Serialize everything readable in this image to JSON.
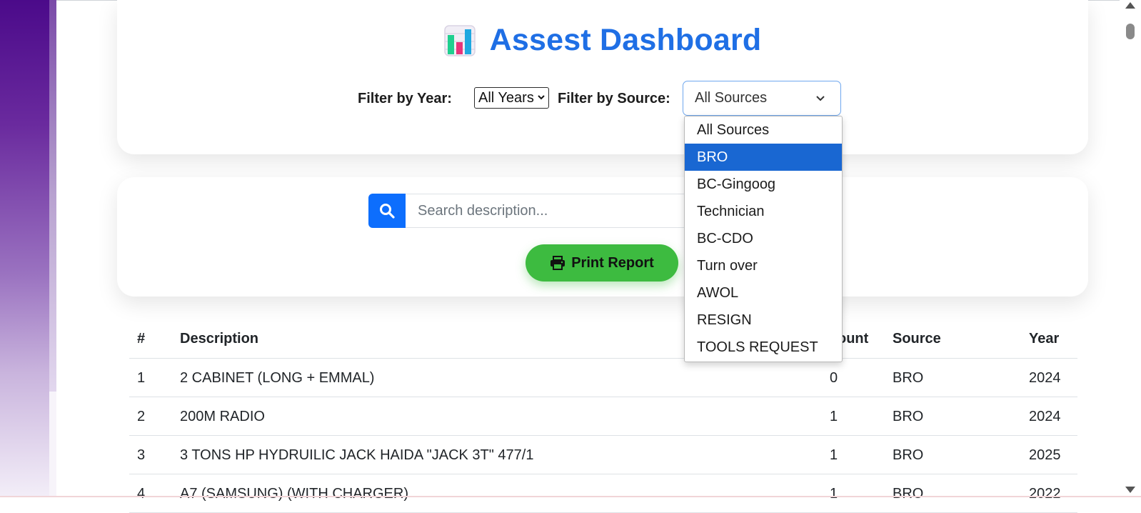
{
  "dashboard": {
    "title": "Assest Dashboard",
    "icon": "bar-chart-icon"
  },
  "filters": {
    "year_label": "Filter by Year:",
    "year_selected": "All Years",
    "source_label": "Filter by Source:",
    "source_selected": "All Sources"
  },
  "source_dropdown": {
    "options": [
      "All Sources",
      "BRO",
      "BC-Gingoog",
      "Technician",
      "BC-CDO",
      "Turn over",
      "AWOL",
      "RESIGN",
      "TOOLS REQUEST"
    ],
    "highlighted": "BRO"
  },
  "search": {
    "placeholder": "Search description..."
  },
  "print_button": {
    "label": "Print Report",
    "color": "#3dbb40"
  },
  "table": {
    "headers": [
      "#",
      "Description",
      "ount",
      "Source",
      "Year"
    ],
    "rows": [
      {
        "num": "1",
        "description": "2 CABINET (LONG + EMMAL)",
        "amount": "0",
        "source": "BRO",
        "year": "2024"
      },
      {
        "num": "2",
        "description": "200M RADIO",
        "amount": "1",
        "source": "BRO",
        "year": "2024"
      },
      {
        "num": "3",
        "description": "3 TONS HP HYDRUILIC JACK HAIDA \"JACK 3T\" 477/1",
        "amount": "1",
        "source": "BRO",
        "year": "2025"
      },
      {
        "num": "4",
        "description": "A7 (SAMSUNG) (WITH CHARGER)",
        "amount": "1",
        "source": "BRO",
        "year": "2022"
      }
    ]
  },
  "colors": {
    "accent": "#1f6fe5",
    "primary_button": "#0d6efd",
    "dropdown_highlight": "#1967d2"
  }
}
